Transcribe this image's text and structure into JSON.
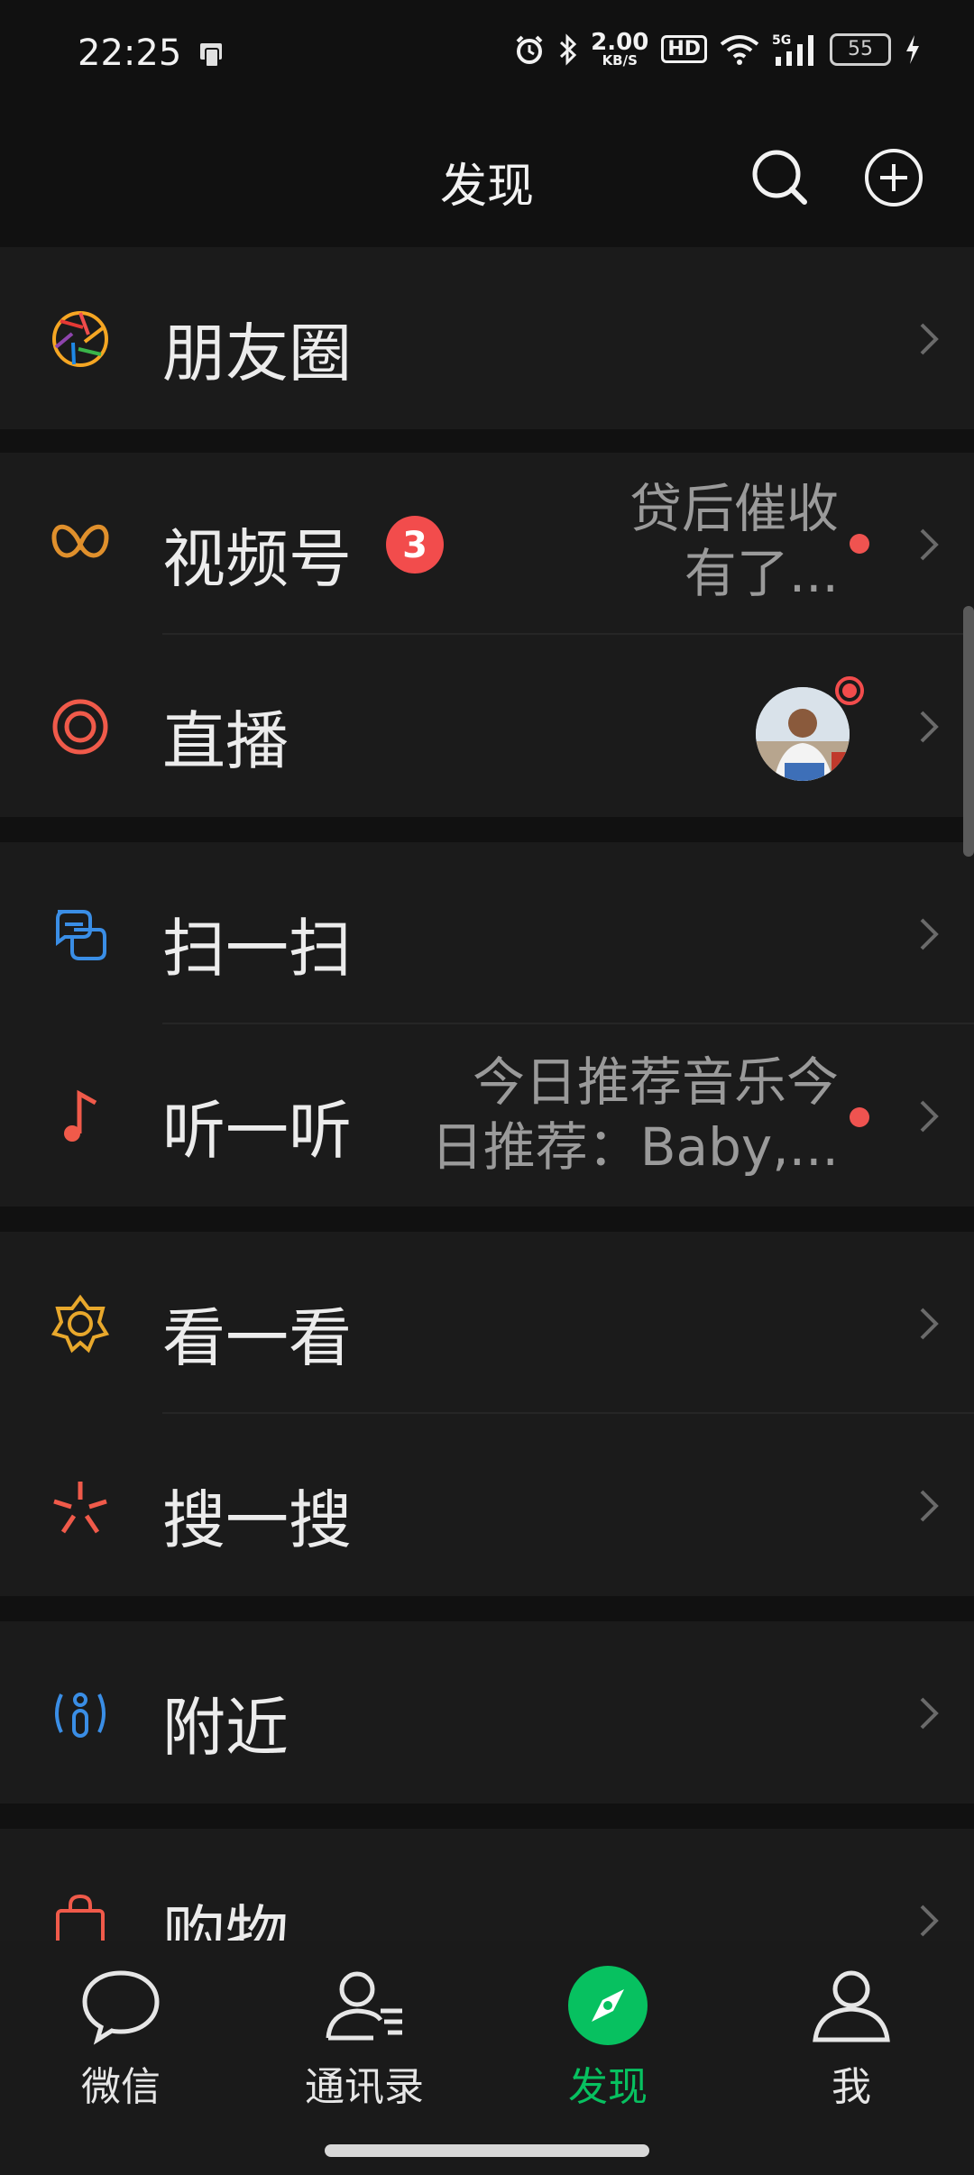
{
  "status": {
    "time": "22:25",
    "speed_value": "2.00",
    "speed_unit": "KB/S",
    "hd": "HD",
    "network": "5G",
    "battery": "55"
  },
  "header": {
    "title": "发现"
  },
  "items": {
    "moments": "朋友圈",
    "channels": "视频号",
    "channels_badge": "3",
    "channels_sub_line1": "贷后催收",
    "channels_sub_line2": "有了...",
    "live": "直播",
    "scan": "扫一扫",
    "listen": "听一听",
    "listen_sub_line1": "今日推荐音乐今",
    "listen_sub_line2": "日推荐：Baby,...",
    "look": "看一看",
    "search": "搜一搜",
    "nearby": "附近",
    "shopping": "购物"
  },
  "tabs": {
    "chats": "微信",
    "contacts": "通讯录",
    "discover": "发现",
    "me": "我"
  },
  "colors": {
    "accent_green": "#07c160",
    "badge_red": "#f24c4c",
    "background": "#111111",
    "cell": "#1b1b1b"
  }
}
